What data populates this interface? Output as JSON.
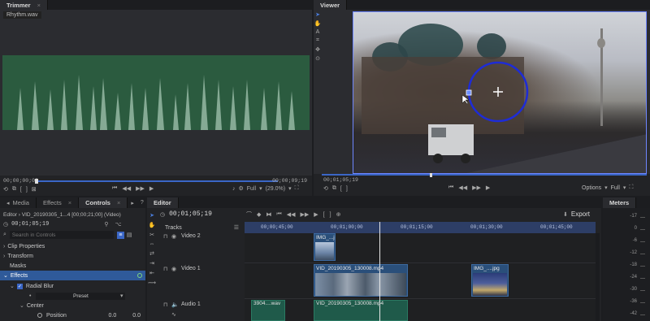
{
  "trimmer": {
    "tab": "Trimmer",
    "tab_close": "×",
    "file": "Rhythm.wav",
    "time_start": "00;00;00;00",
    "time_end": "00;00;09;19",
    "view_label": "Full",
    "zoom_label": "(29.0%)"
  },
  "viewer": {
    "tab": "Viewer",
    "options": "Options",
    "view_label": "Full"
  },
  "controls": {
    "tabs": [
      {
        "label": "Media",
        "active": false
      },
      {
        "label": "Effects",
        "active": false
      },
      {
        "label": "Controls",
        "active": true
      }
    ],
    "breadcrumb": "Editor › VID_20190305_1...4 [00;00;21;00] (Video)",
    "time": "00;01;05;19",
    "search_placeholder": "Search in Controls",
    "sections": {
      "clip_properties": "Clip Properties",
      "transform": "Transform",
      "masks": "Masks",
      "effects": "Effects",
      "radial_blur": "Radial Blur",
      "preset": "Preset",
      "center": "Center",
      "position": "Position",
      "pos_x": "0.0",
      "pos_y": "0.0"
    }
  },
  "editor": {
    "tab": "Editor",
    "time": "00;01;05;19",
    "tracks_label": "Tracks",
    "export": "Export",
    "ruler": [
      "00;00;45;00",
      "00;01;00;00",
      "00;01;15;00",
      "00;01;30;00",
      "00;01;45;00"
    ],
    "playhead_fraction": 0.385,
    "tracks": [
      {
        "name": "Video 2"
      },
      {
        "name": "Video 1"
      },
      {
        "name": "Audio 1"
      }
    ],
    "clips": {
      "v2_clip": "IMG_...jpg",
      "v1_clip1": "VID_20190305_130008.mp4",
      "v1_clip2": "IMG_....jpg",
      "a1_clip1": "3904....wav",
      "a1_clip2": "VID_20190305_130008.mp4"
    }
  },
  "meters": {
    "tab": "Meters",
    "scale": [
      "-17",
      "0",
      "-6",
      "-12",
      "-18",
      "-24",
      "-30",
      "-36",
      "-42"
    ]
  },
  "colors": {
    "accent": "#3a66c6",
    "waveform_bg": "#2b5b3f",
    "waveform_fg": "#8fb39e",
    "video_clip": "#2a4f7a",
    "audio_clip": "#1f5a4a",
    "selected_row": "#2f5a9a"
  }
}
